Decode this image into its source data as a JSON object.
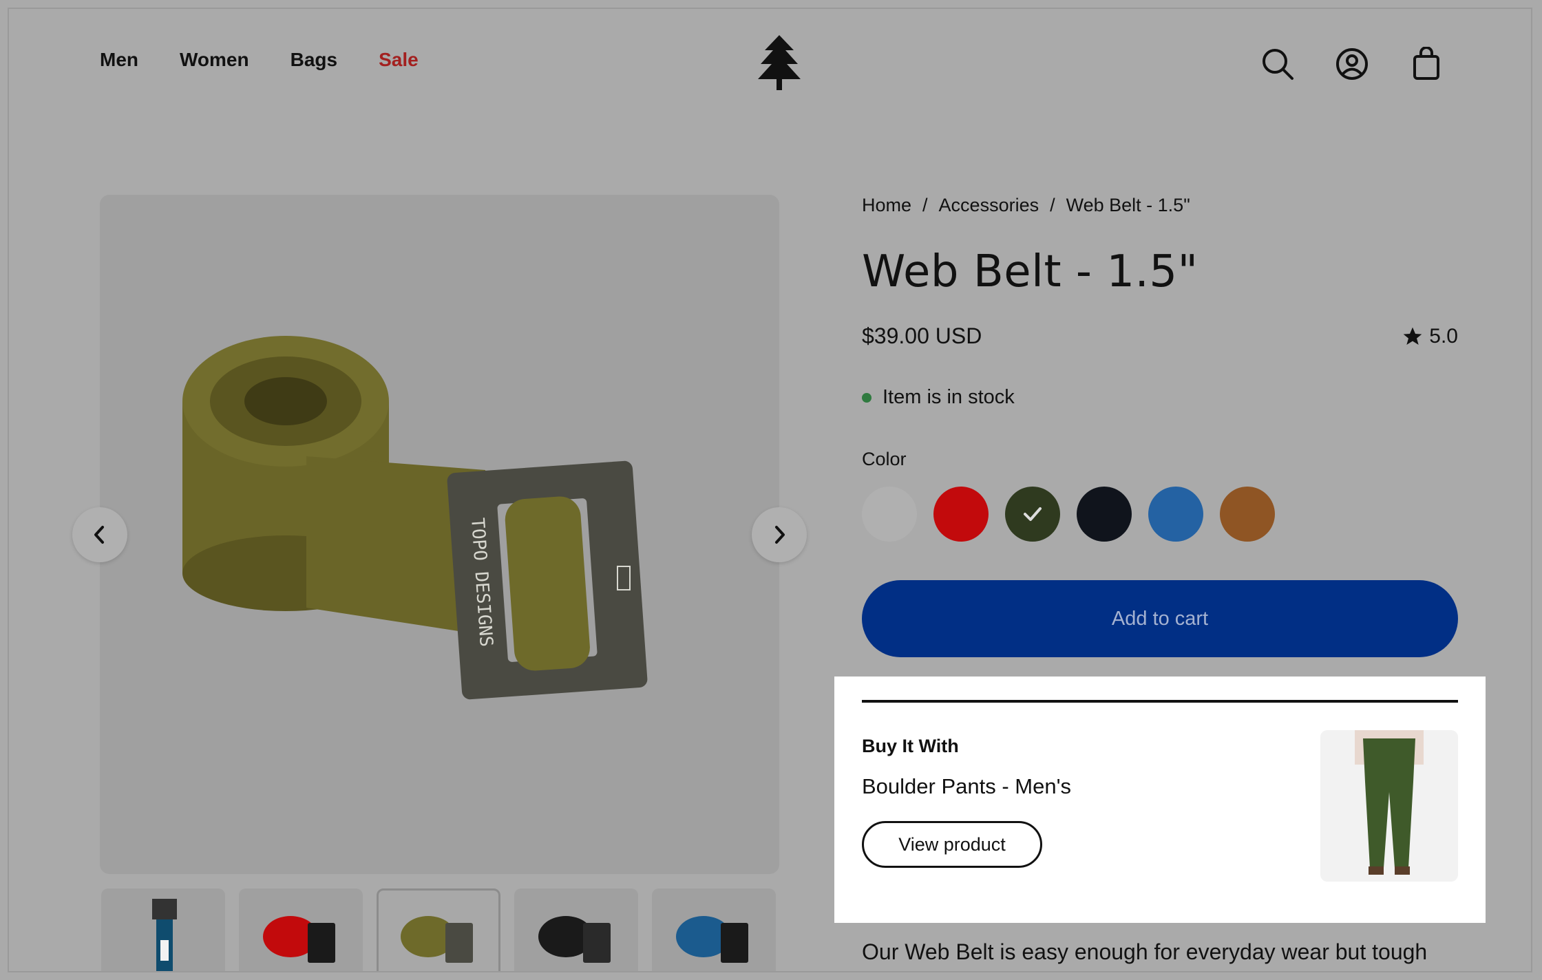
{
  "header": {
    "nav": [
      "Men",
      "Women",
      "Bags",
      "Sale"
    ],
    "icons": [
      "search-icon",
      "account-icon",
      "bag-icon"
    ],
    "logo": "tree-logo"
  },
  "breadcrumb": [
    "Home",
    "/",
    "Accessories",
    "/",
    "Web Belt - 1.5\""
  ],
  "product": {
    "title": "Web Belt - 1.5\"",
    "price": "$39.00 USD",
    "rating": "5.0",
    "stock": "Item is in stock",
    "color_label": "Color",
    "colors": [
      "#b0b0b0",
      "#c20a0c",
      "#2f3a1f",
      "#10141c",
      "#2462a3",
      "#8f5524"
    ],
    "selected_color_index": 2,
    "add_to_cart": "Add to cart"
  },
  "gallery": {
    "brand_text": "TOPO DESIGNS",
    "thumb_colors": [
      "#0f4c6e",
      "#c20a0c",
      "#6e6a2a",
      "#1a1a1a",
      "#1b5b8e"
    ],
    "active_thumb": 2
  },
  "buy_it_with": {
    "heading": "Buy It With",
    "product_name": "Boulder Pants - Men's",
    "button": "View product"
  },
  "description": "Our Web Belt is easy enough for everyday wear but tough"
}
